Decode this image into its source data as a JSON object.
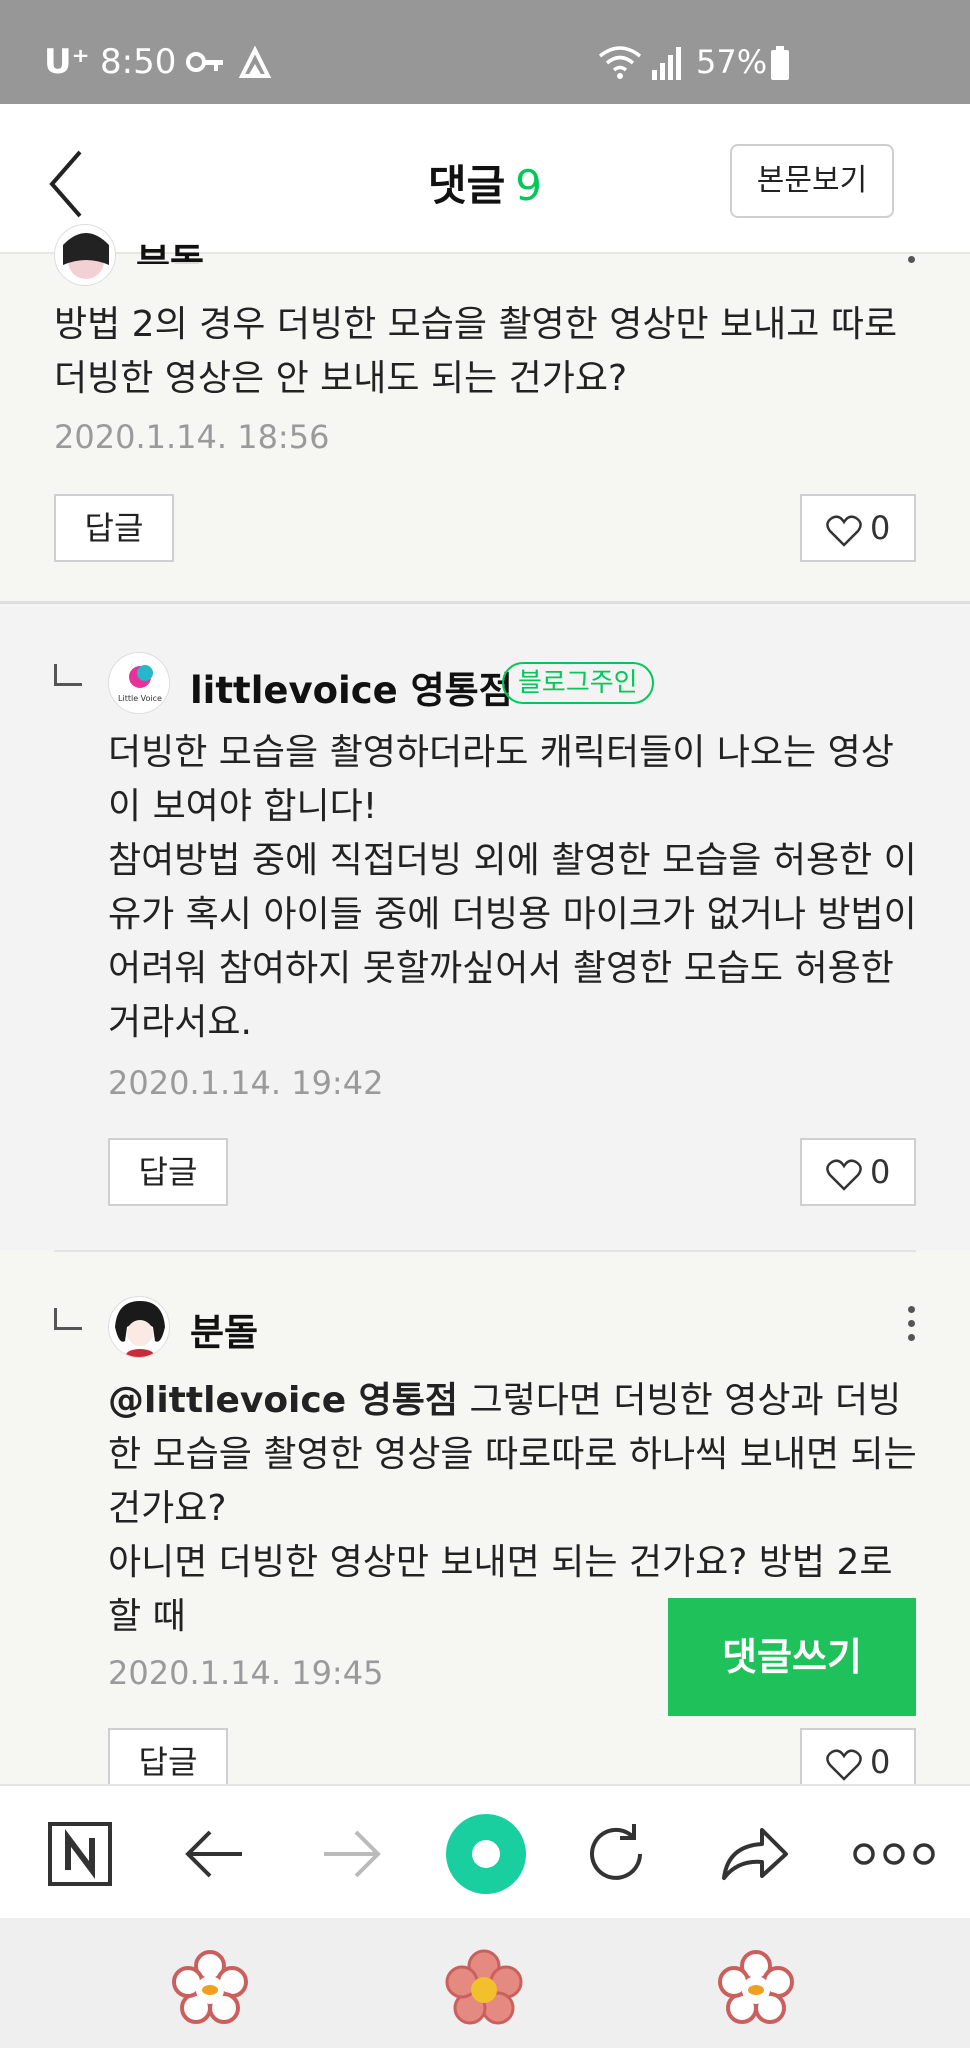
{
  "status_bar": {
    "carrier": "U⁺",
    "time": "8:50",
    "battery": "57%"
  },
  "header": {
    "title": "댓글",
    "count": "9",
    "view_post_label": "본문보기"
  },
  "comments": [
    {
      "author": "분돌",
      "text": "방법 2의 경우 더빙한 모습을 촬영한 영상만 보내고 따로 더빙한 영상은 안 보내도 되는 건가요?",
      "date": "2020.1.14. 18:56",
      "reply_label": "답글",
      "likes": "0"
    },
    {
      "author": "littlevoice 영통점",
      "badge": "블로그주인",
      "text": "더빙한 모습을 촬영하더라도 캐릭터들이 나오는 영상이 보여야 합니다!\n참여방법 중에 직접더빙 외에 촬영한 모습을 허용한 이유가 혹시 아이들 중에 더빙용 마이크가 없거나 방법이 어려워 참여하지 못할까싶어서 촬영한 모습도 허용한 거라서요.",
      "date": "2020.1.14. 19:42",
      "reply_label": "답글",
      "likes": "0"
    },
    {
      "author": "분돌",
      "mention": "@littlevoice 영통점",
      "text": "그렇다면 더빙한 영상과 더빙한 모습을 촬영한 영상을 따로따로 하나씩 보내면 되는 건가요?\n아니면 더빙한 영상만 보내면 되는 건가요? 방법 2로 할 때",
      "date": "2020.1.14. 19:45",
      "reply_label": "답글",
      "likes": "0"
    }
  ],
  "write_comment_label": "댓글쓰기",
  "colors": {
    "accent_green": "#03c75a",
    "write_button": "#1fc25a",
    "status_bar": "#979797"
  },
  "icons": {
    "toolbar": [
      "naver-home-icon",
      "back-arrow-icon",
      "forward-arrow-icon",
      "green-dot-icon",
      "refresh-icon",
      "share-icon",
      "more-icon"
    ],
    "navbar": [
      "flower-left-icon",
      "flower-center-icon",
      "flower-right-icon"
    ]
  }
}
